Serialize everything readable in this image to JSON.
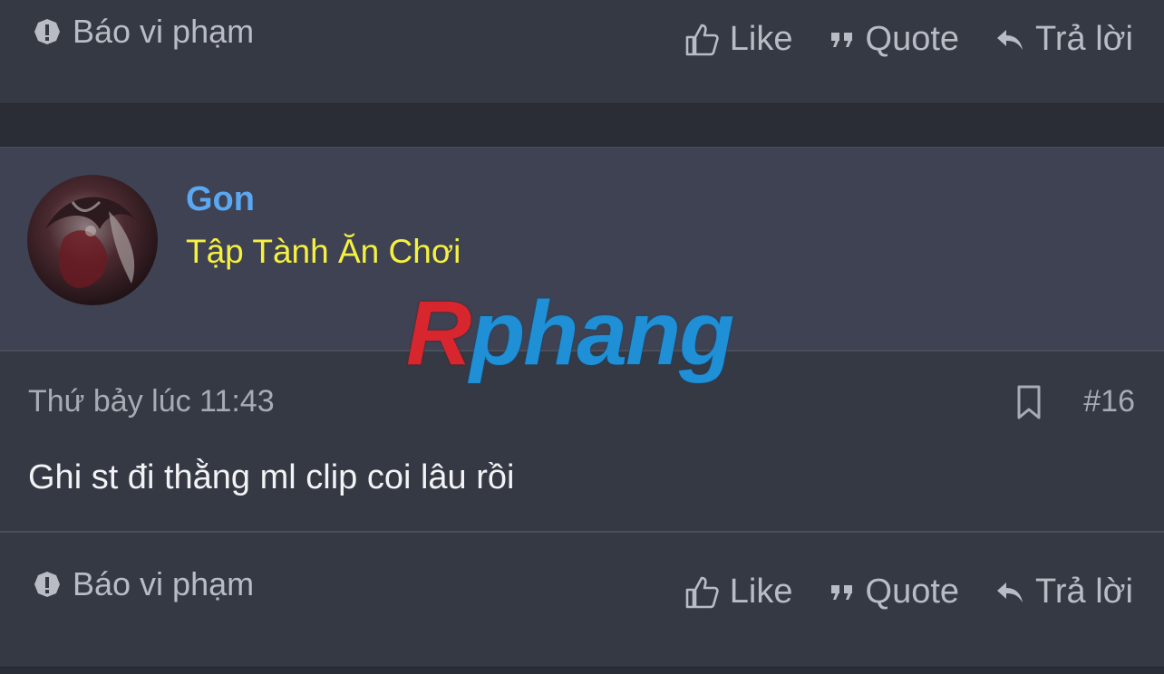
{
  "top_bar": {
    "report_label": "Báo vi phạm",
    "like_label": "Like",
    "quote_label": "Quote",
    "reply_label": "Trả lời"
  },
  "post": {
    "username": "Gon",
    "user_title": "Tập Tành Ăn Chơi",
    "date": "Thứ bảy lúc 11:43",
    "number": "#16",
    "content": "Ghi st đi thằng ml clip coi lâu rồi"
  },
  "bottom_bar": {
    "report_label": "Báo vi phạm",
    "like_label": "Like",
    "quote_label": "Quote",
    "reply_label": "Trả lời"
  },
  "watermark": {
    "first_letter": "R",
    "rest": "phang"
  },
  "colors": {
    "username": "#5aa7f2",
    "user_title": "#f5f142",
    "background": "#2a2d36",
    "header_bg": "#3e4252"
  }
}
